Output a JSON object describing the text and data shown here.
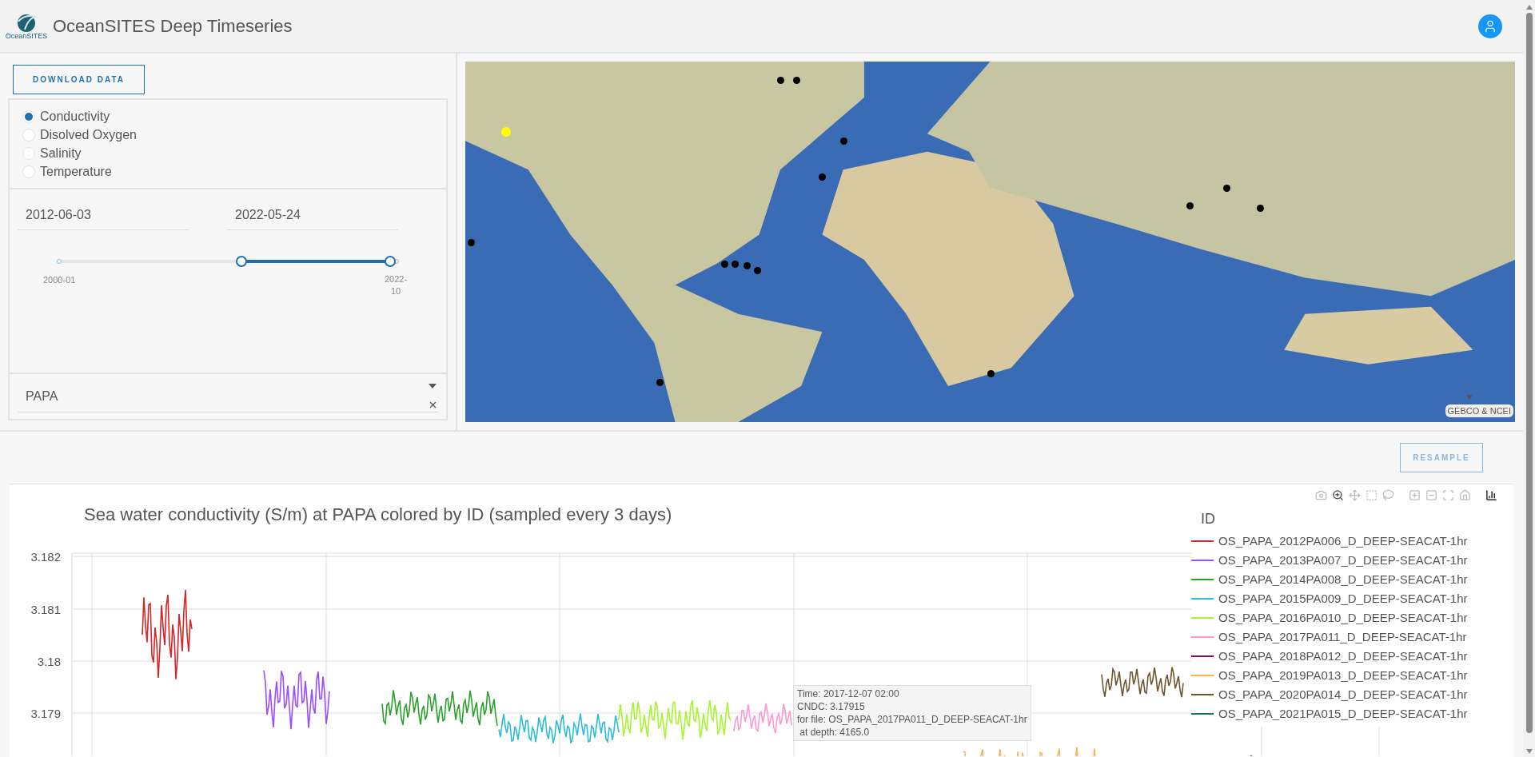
{
  "header": {
    "logo_text": "OceanSITES",
    "title": "OceanSITES Deep Timeseries"
  },
  "controls": {
    "download_button": "DOWNLOAD DATA",
    "variables": [
      {
        "label": "Conductivity",
        "selected": true
      },
      {
        "label": "Disolved Oxygen",
        "selected": false
      },
      {
        "label": "Salinity",
        "selected": false
      },
      {
        "label": "Temperature",
        "selected": false
      }
    ],
    "start_date": "2012-06-03",
    "end_date": "2022-05-24",
    "slider": {
      "min_label": "2000-01",
      "max_label": "2022-10",
      "thumbs": [
        {
          "level": 0.54
        },
        {
          "level": 0.98
        }
      ]
    },
    "site_select": {
      "value": "PAPA"
    }
  },
  "map": {
    "attribution": "GEBCO & NCEI",
    "markers": [
      {
        "selected": true
      },
      {
        "selected": false
      },
      {
        "selected": false
      },
      {
        "selected": false
      },
      {
        "selected": false
      },
      {
        "selected": false
      },
      {
        "selected": false
      },
      {
        "selected": false
      },
      {
        "selected": false
      },
      {
        "selected": false
      },
      {
        "selected": false
      },
      {
        "selected": false
      },
      {
        "selected": false
      },
      {
        "selected": false
      },
      {
        "selected": false
      }
    ]
  },
  "plot": {
    "resample_button": "RESAMPLE",
    "title": "Sea water conductivity (S/m) at PAPA colored by ID (sampled every 3 days)",
    "yticks": [
      "3.182",
      "3.181",
      "3.18",
      "3.179"
    ],
    "legend_title": "ID",
    "legend": [
      {
        "label": "OS_PAPA_2012PA006_D_DEEP-SEACAT-1hr",
        "color": "#d62728"
      },
      {
        "label": "OS_PAPA_2013PA007_D_DEEP-SEACAT-1hr",
        "color": "#9b4dff"
      },
      {
        "label": "OS_PAPA_2014PA008_D_DEEP-SEACAT-1hr",
        "color": "#2ca02c"
      },
      {
        "label": "OS_PAPA_2015PA009_D_DEEP-SEACAT-1hr",
        "color": "#2bbcd6"
      },
      {
        "label": "OS_PAPA_2016PA010_D_DEEP-SEACAT-1hr",
        "color": "#a6f52f"
      },
      {
        "label": "OS_PAPA_2017PA011_D_DEEP-SEACAT-1hr",
        "color": "#ff99d0"
      },
      {
        "label": "OS_PAPA_2018PA012_D_DEEP-SEACAT-1hr",
        "color": "#6b1360"
      },
      {
        "label": "OS_PAPA_2019PA013_D_DEEP-SEACAT-1hr",
        "color": "#ffb24f"
      },
      {
        "label": "OS_PAPA_2020PA014_D_DEEP-SEACAT-1hr",
        "color": "#6e5630"
      },
      {
        "label": "OS_PAPA_2021PA015_D_DEEP-SEACAT-1hr",
        "color": "#1d6e6a"
      }
    ],
    "tooltip": [
      "Time: 2017-12-07 02:00",
      "CNDC: 3.17915",
      "for file: OS_PAPA_2017PA011_D_DEEP-SEACAT-1hr",
      " at depth: 4165.0"
    ]
  }
}
